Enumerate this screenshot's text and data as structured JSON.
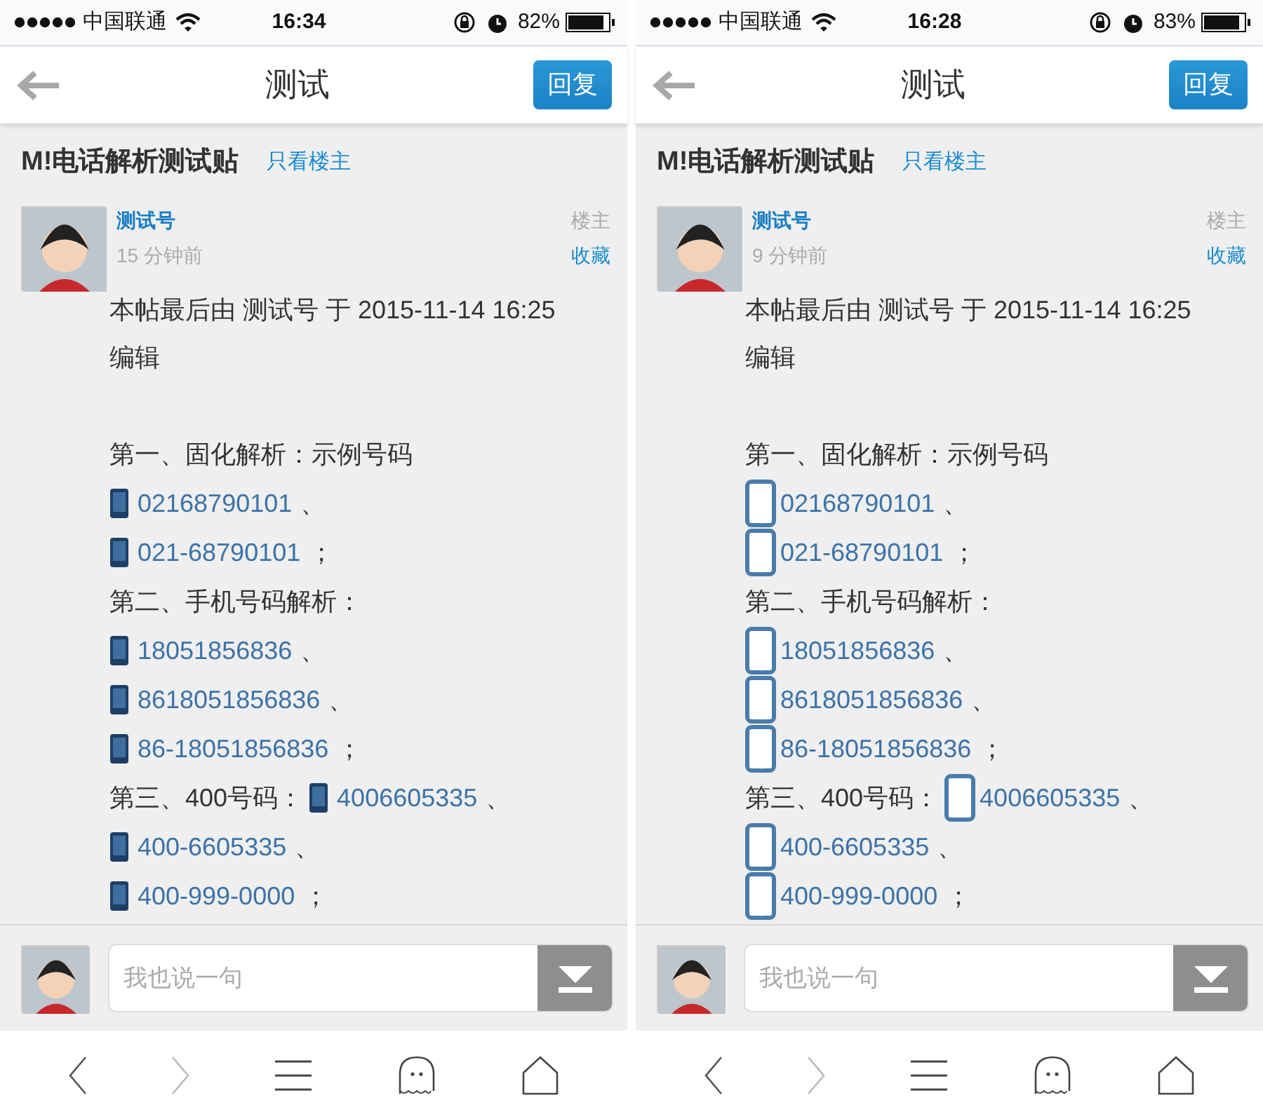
{
  "screens": [
    {
      "status_bar": {
        "carrier": "中国联通",
        "time": "16:34",
        "battery": "82%"
      },
      "nav": {
        "title": "测试",
        "reply_button": "回复"
      },
      "post": {
        "title": "M!电话解析测试贴",
        "op_only_link": "只看楼主",
        "author": "测试号",
        "time_ago": "15 分钟前",
        "op_label": "楼主",
        "favorite": "收藏",
        "kind": "filled",
        "edit_note": "本帖最后由 测试号 于 2015-11-14 16:25 编辑",
        "lines": [
          [
            {
              "kind": "text",
              "text": "第一、固化解析：示例号码"
            }
          ],
          [
            {
              "kind": "phone",
              "text": "02168790101"
            },
            {
              "kind": "text",
              "text": "、"
            }
          ],
          [
            {
              "kind": "phone",
              "text": "021-68790101"
            },
            {
              "kind": "text",
              "text": "；"
            }
          ],
          [
            {
              "kind": "text",
              "text": "第二、手机号码解析："
            }
          ],
          [
            {
              "kind": "phone",
              "text": "18051856836"
            },
            {
              "kind": "text",
              "text": "、"
            }
          ],
          [
            {
              "kind": "phone",
              "text": "8618051856836"
            },
            {
              "kind": "text",
              "text": "、"
            }
          ],
          [
            {
              "kind": "phone",
              "text": "86-18051856836"
            },
            {
              "kind": "text",
              "text": "；"
            }
          ],
          [
            {
              "kind": "text",
              "text": "第三、400号码："
            },
            {
              "kind": "phone",
              "text": "4006605335"
            },
            {
              "kind": "text",
              "text": "、"
            }
          ],
          [
            {
              "kind": "phone",
              "text": "400-6605335"
            },
            {
              "kind": "text",
              "text": "、"
            }
          ],
          [
            {
              "kind": "phone",
              "text": "400-999-0000"
            },
            {
              "kind": "text",
              "text": "；"
            }
          ]
        ]
      },
      "comment_box": {
        "placeholder": "我也说一句"
      }
    },
    {
      "status_bar": {
        "carrier": "中国联通",
        "time": "16:28",
        "battery": "83%"
      },
      "nav": {
        "title": "测试",
        "reply_button": "回复"
      },
      "post": {
        "title": "M!电话解析测试贴",
        "op_only_link": "只看楼主",
        "author": "测试号",
        "time_ago": "9 分钟前",
        "op_label": "楼主",
        "favorite": "收藏",
        "kind": "outline",
        "edit_note": "本帖最后由 测试号 于 2015-11-14 16:25 编辑",
        "lines": [
          [
            {
              "kind": "text",
              "text": "第一、固化解析：示例号码"
            }
          ],
          [
            {
              "kind": "phone",
              "text": "02168790101"
            },
            {
              "kind": "text",
              "text": "、"
            }
          ],
          [
            {
              "kind": "phone",
              "text": "021-68790101"
            },
            {
              "kind": "text",
              "text": "；"
            }
          ],
          [
            {
              "kind": "text",
              "text": "第二、手机号码解析："
            }
          ],
          [
            {
              "kind": "phone",
              "text": "18051856836"
            },
            {
              "kind": "text",
              "text": "、"
            }
          ],
          [
            {
              "kind": "phone",
              "text": "8618051856836"
            },
            {
              "kind": "text",
              "text": "、"
            }
          ],
          [
            {
              "kind": "phone",
              "text": "86-18051856836"
            },
            {
              "kind": "text",
              "text": "；"
            }
          ],
          [
            {
              "kind": "text",
              "text": "第三、400号码："
            },
            {
              "kind": "phone",
              "text": "4006605335"
            },
            {
              "kind": "text",
              "text": "、"
            }
          ],
          [
            {
              "kind": "phone",
              "text": "400-6605335"
            },
            {
              "kind": "text",
              "text": "、"
            }
          ],
          [
            {
              "kind": "phone",
              "text": "400-999-0000"
            },
            {
              "kind": "text",
              "text": "；"
            }
          ]
        ]
      },
      "comment_box": {
        "placeholder": "我也说一句"
      }
    }
  ]
}
